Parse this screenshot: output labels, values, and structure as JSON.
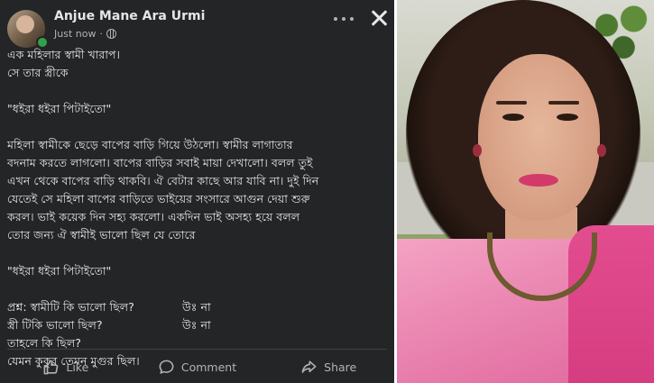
{
  "post": {
    "author_name": "Anjue Mane Ara Urmi",
    "timestamp": "Just now",
    "privacy_icon": "globe-icon",
    "more_icon": "more-horizontal-icon",
    "close_icon": "close-icon",
    "lines": [
      "এক মহিলার স্বামী খারাপ।",
      "সে তার স্ত্রীকে",
      "",
      "\"ধইরা ধইরা পিটাইতো\"",
      "",
      "মহিলা স্বামীকে ছেড়ে বাপের বাড়ি গিয়ে উঠলো। স্বামীর লাগাতার",
      "বদনাম করতে লাগলো। বাপের বাড়ির সবাই মায়া দেখালো। বলল তুই",
      "এখন থেকে বাপের বাড়ি থাকবি। ঐ বেটার কাছে আর যাবি না। দুই দিন",
      "যেতেই সে মহিলা বাপের বাড়িতে ভাইয়ের সংসারে আগুন দেয়া শুরু",
      "করল। ভাই কয়েক দিন সহ্য করলো। একদিন ভাই অসহ্য হয়ে বলল",
      "তোর জন্য ঐ স্বামীই ভালো ছিল যে তোরে",
      "",
      "\"ধইরা ধইরা পিটাইতো\"",
      ""
    ],
    "qa": [
      {
        "q": "প্রশ্ন: স্বামীটি কি ভালো ছিল?",
        "a": "উঃ না"
      },
      {
        "q": "স্ত্রী টিকি ভালো ছিল?",
        "a": "উঃ না"
      }
    ],
    "closing_lines": [
      "তাহলে কি ছিল?",
      "যেমন কুকুর তেমন মুগুর ছিল।"
    ]
  },
  "actions": [
    {
      "label": "Like",
      "icon": "like-icon"
    },
    {
      "label": "Comment",
      "icon": "comment-icon"
    },
    {
      "label": "Share",
      "icon": "share-icon"
    }
  ],
  "colors": {
    "post_background": "#242526",
    "text_primary": "#e4e6eb",
    "text_secondary": "#b0b3b8",
    "online_indicator": "#31a24c"
  }
}
